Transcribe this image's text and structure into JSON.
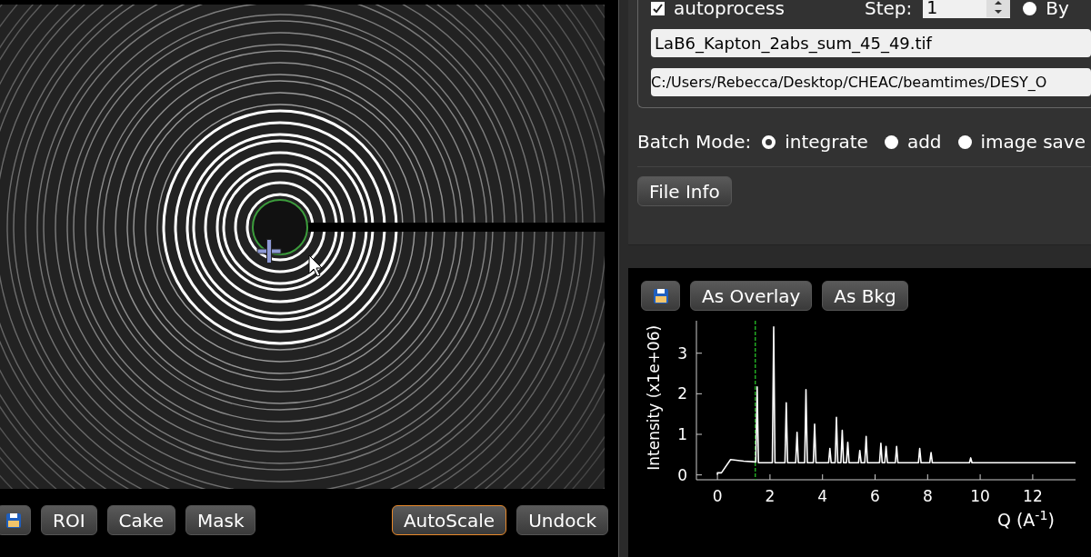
{
  "image_toolbar": {
    "buttons": [
      {
        "label": "ROI",
        "highlighted": false
      },
      {
        "label": "Cake",
        "highlighted": false
      },
      {
        "label": "Mask",
        "highlighted": false
      }
    ],
    "right_buttons": [
      {
        "label": "AutoScale",
        "highlighted": true
      },
      {
        "label": "Undock",
        "highlighted": false
      }
    ]
  },
  "process_panel": {
    "autoprocess": {
      "label": "autoprocess",
      "checked": true
    },
    "step": {
      "label": "Step:",
      "value": "1"
    },
    "by_option": {
      "label": "By",
      "selected": false
    },
    "file_name": "LaB6_Kapton_2abs_sum_45_49.tif",
    "file_path": "C:/Users/Rebecca/Desktop/CHEAC/beamtimes/DESY_O",
    "batch_mode": {
      "label": "Batch Mode:",
      "options": [
        {
          "label": "integrate",
          "selected": true
        },
        {
          "label": "add",
          "selected": false
        },
        {
          "label": "image save",
          "selected": false
        }
      ]
    },
    "file_info_button": "File Info"
  },
  "plot_panel": {
    "buttons": [
      "As Overlay",
      "As Bkg"
    ],
    "chart_data": {
      "type": "line",
      "xlabel": "Q (A$^{-1}$)",
      "ylabel": "Intensity (x1e+06)",
      "xlim": [
        -0.8,
        13.63
      ],
      "ylim": [
        -0.12,
        3.8
      ],
      "xticks": [
        0,
        2,
        4,
        6,
        8,
        10,
        12
      ],
      "yticks": [
        0,
        1,
        2,
        3
      ],
      "x": [
        0,
        0,
        0.15,
        0.5,
        1.0,
        1.46,
        1.51,
        1.56,
        2.09,
        2.14,
        2.19,
        2.57,
        2.62,
        2.67,
        2.98,
        3.03,
        3.08,
        3.32,
        3.37,
        3.42,
        3.65,
        3.7,
        3.75,
        4.23,
        4.28,
        4.33,
        4.48,
        4.53,
        4.58,
        4.7,
        4.75,
        4.8,
        4.91,
        4.96,
        5.01,
        5.37,
        5.42,
        5.47,
        5.61,
        5.66,
        5.71,
        6.17,
        6.22,
        6.27,
        6.37,
        6.42,
        6.47,
        6.77,
        6.82,
        6.87,
        7.65,
        7.7,
        7.75,
        8.08,
        8.13,
        8.18,
        9.59,
        9.64,
        9.69,
        13.63
      ],
      "series": [
        {
          "color": "#ffffff",
          "values": [
            0,
            0.05,
            0.05,
            0.38,
            0.34,
            0.32,
            2.17,
            0.3,
            0.3,
            3.65,
            0.3,
            0.3,
            1.78,
            0.3,
            0.3,
            1.05,
            0.3,
            0.3,
            2.1,
            0.3,
            0.3,
            1.25,
            0.3,
            0.3,
            0.65,
            0.3,
            0.3,
            1.42,
            0.3,
            0.3,
            1.1,
            0.3,
            0.3,
            0.8,
            0.3,
            0.3,
            0.6,
            0.3,
            0.3,
            0.95,
            0.3,
            0.3,
            0.78,
            0.3,
            0.3,
            0.7,
            0.3,
            0.3,
            0.7,
            0.3,
            0.3,
            0.65,
            0.3,
            0.3,
            0.55,
            0.3,
            0.3,
            0.42,
            0.3,
            0.3
          ]
        }
      ],
      "ref_lines": [
        {
          "axis": "x",
          "value": 1.44,
          "color": "#22aa22"
        }
      ]
    }
  }
}
